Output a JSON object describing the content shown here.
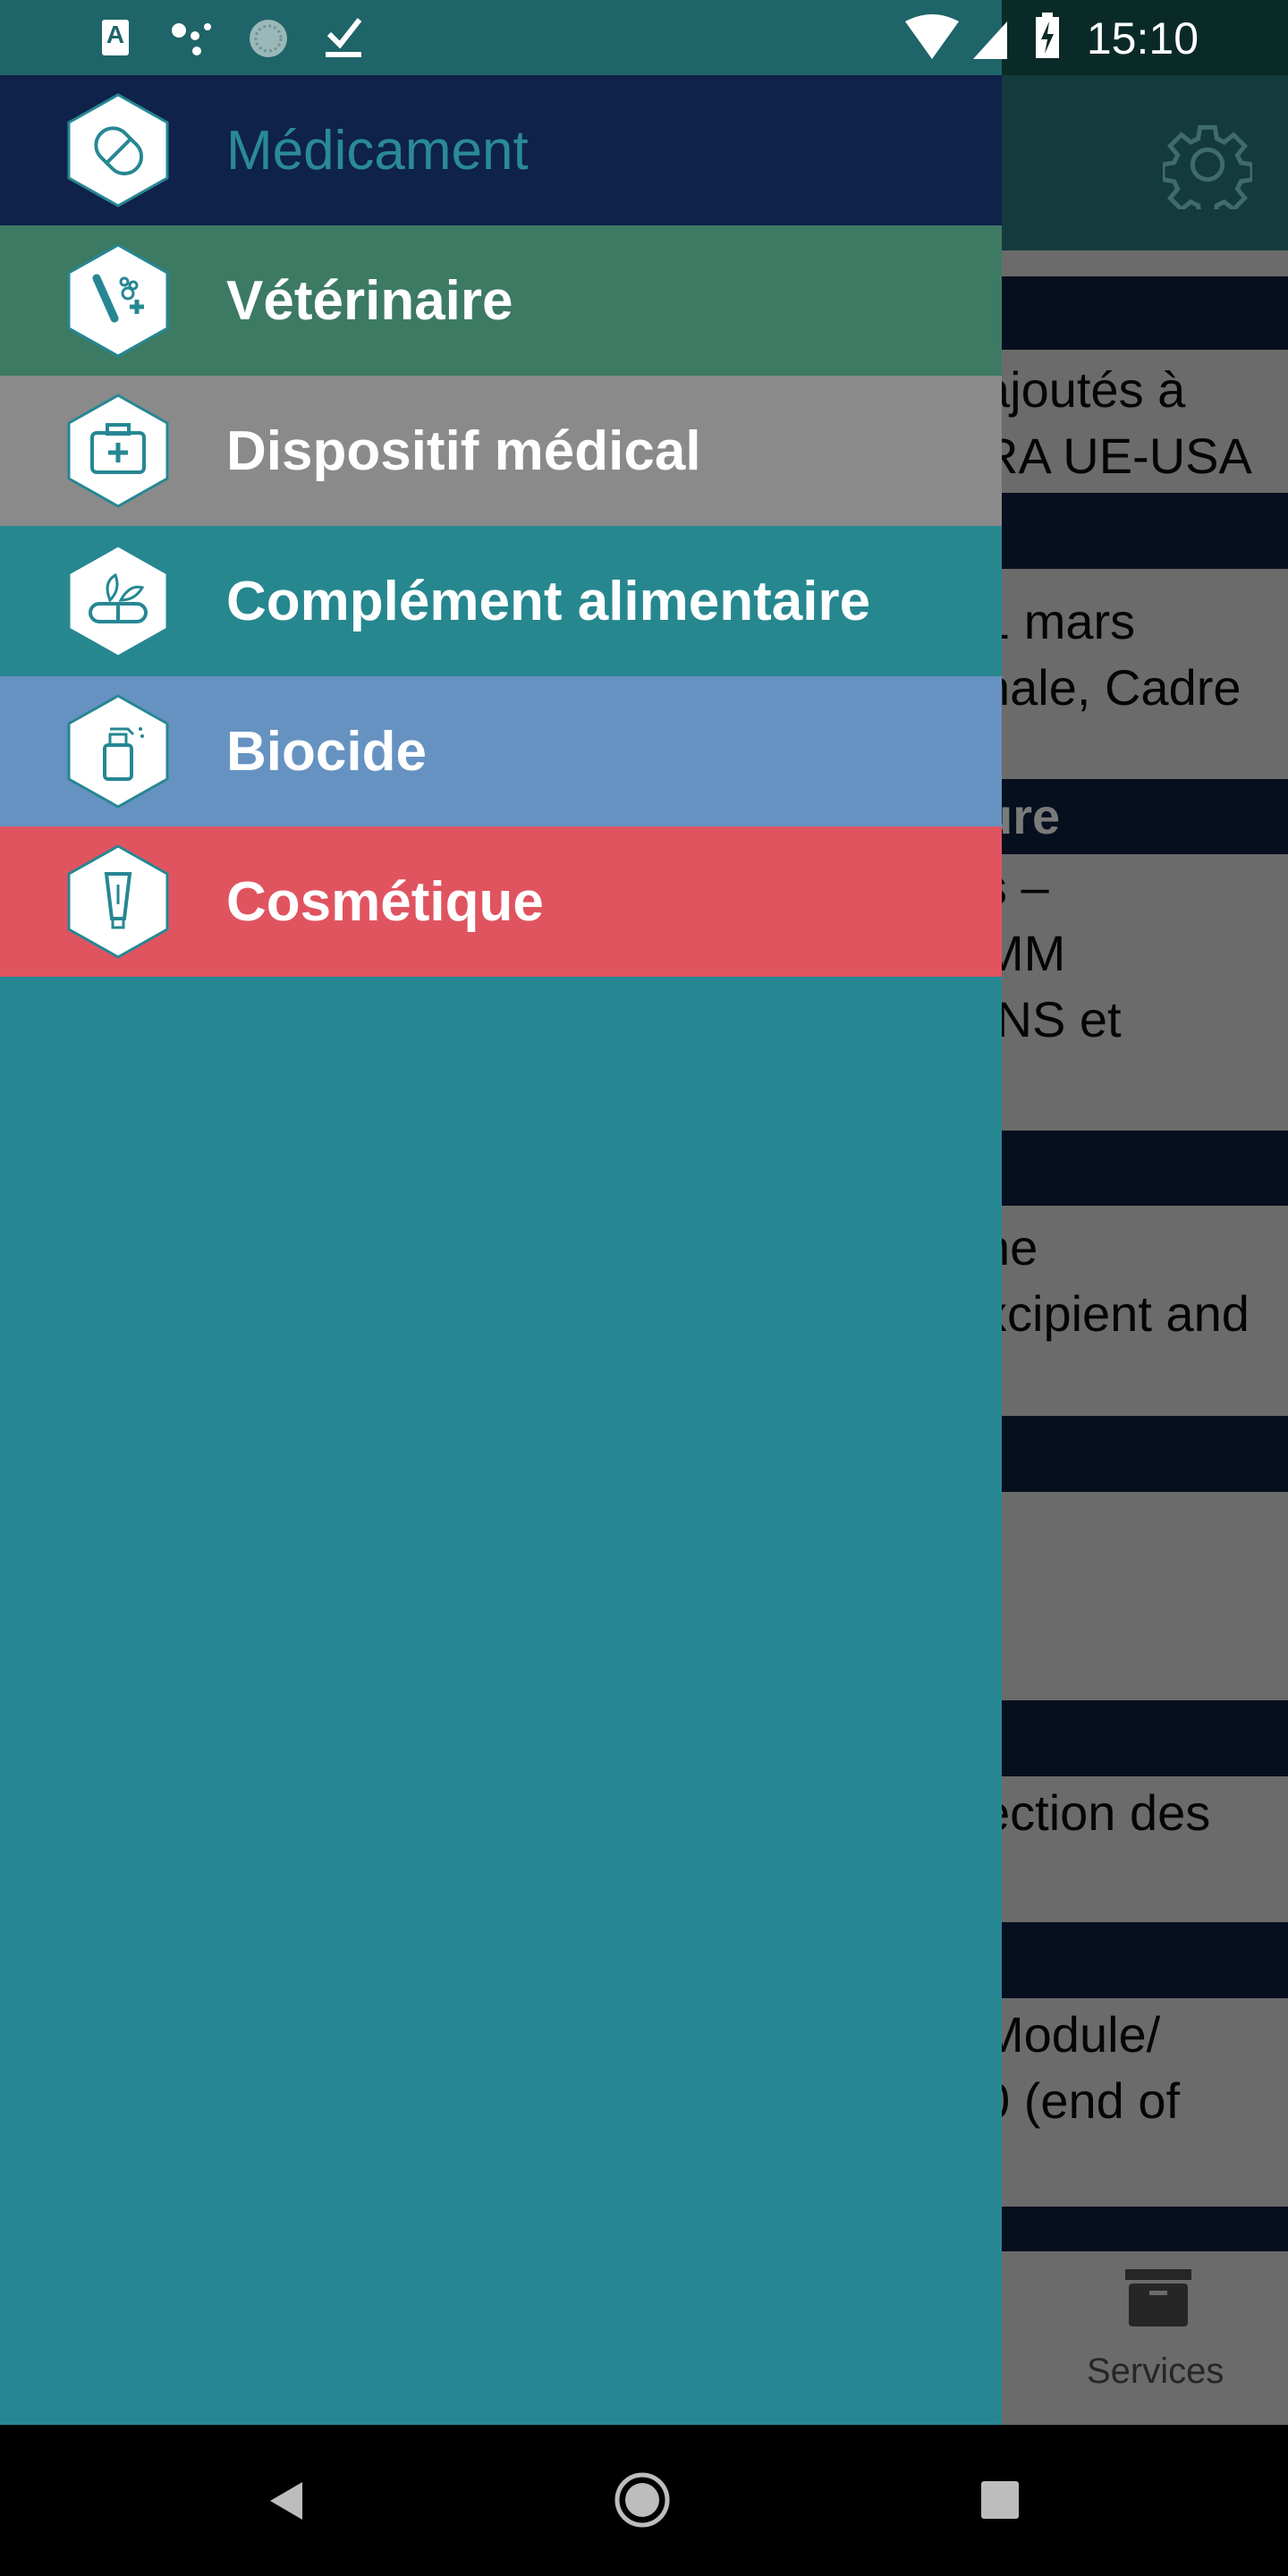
{
  "status_bar": {
    "time": "15:10",
    "icons": [
      "font-a-icon",
      "assistant-dots-icon",
      "sync-circle-icon",
      "download-done-icon",
      "wifi-icon",
      "signal-icon",
      "battery-charging-icon"
    ]
  },
  "drawer": {
    "items": [
      {
        "label": "Médicament",
        "icon": "pill-icon",
        "bg": "#0f2249",
        "color": "#2a8a95",
        "selected": true
      },
      {
        "label": "Vétérinaire",
        "icon": "bone-paw-icon",
        "bg": "#3d7a63",
        "color": "#ffffff"
      },
      {
        "label": "Dispositif médical",
        "icon": "medical-kit-icon",
        "bg": "#8a8a8a",
        "color": "#ffffff"
      },
      {
        "label": "Complément alimentaire",
        "icon": "capsule-leaf-icon",
        "bg": "#26878f",
        "color": "#ffffff"
      },
      {
        "label": "Biocide",
        "icon": "spray-bottle-icon",
        "bg": "#6692c2",
        "color": "#ffffff"
      },
      {
        "label": "Cosmétique",
        "icon": "cream-tube-icon",
        "bg": "#e05460",
        "color": "#ffffff"
      }
    ]
  },
  "background": {
    "cards": [
      {
        "header": "",
        "lines": [
          "ajoutés à",
          "RA UE-USA"
        ]
      },
      {
        "header": "",
        "lines": [
          "1 mars",
          "nale, Cadre"
        ]
      },
      {
        "header": "ure",
        "lines": [
          "s –",
          "MM",
          "INS et"
        ]
      },
      {
        "header": "",
        "lines": [
          "ne",
          "xcipient and"
        ]
      },
      {
        "header": "",
        "lines": []
      },
      {
        "header": "",
        "lines": [
          "ection des"
        ]
      },
      {
        "header": "",
        "lines": [
          "Module/",
          "0 (end of"
        ]
      }
    ],
    "bottom_nav": {
      "services": "Services"
    }
  }
}
